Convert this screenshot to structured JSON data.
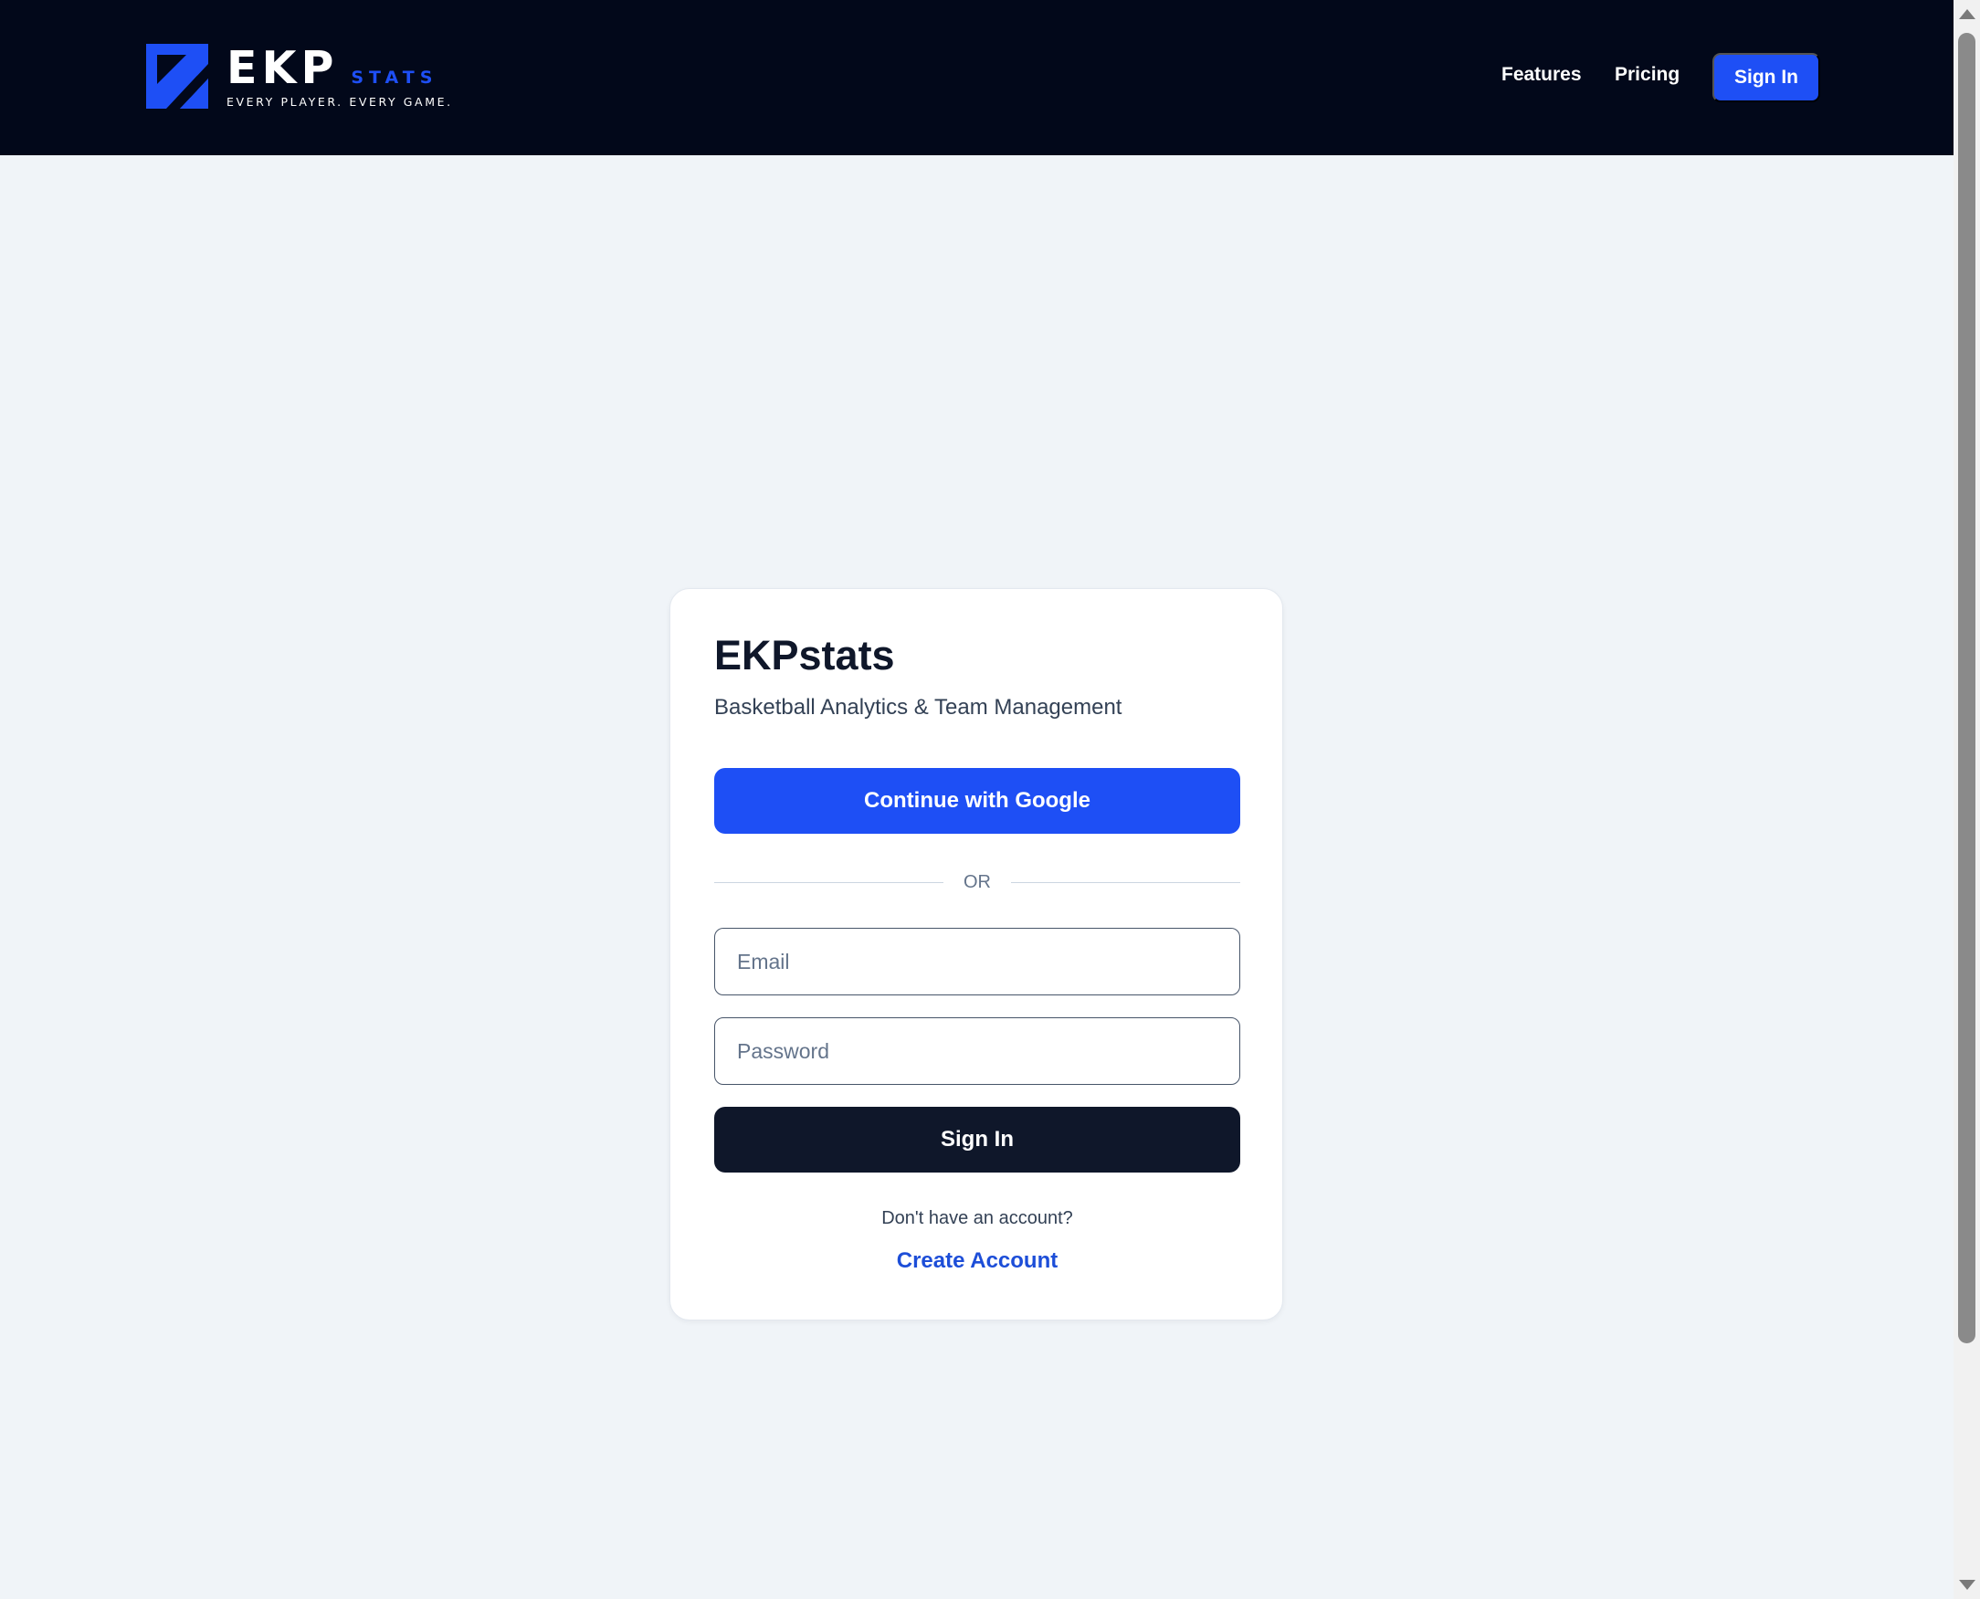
{
  "header": {
    "logo": {
      "name": "EKP",
      "suffix": "STATS",
      "tagline": "EVERY PLAYER. EVERY GAME.",
      "icon": "ekp-logo-mark"
    },
    "nav": {
      "features": "Features",
      "pricing": "Pricing",
      "sign_in": "Sign In"
    }
  },
  "card": {
    "title": "EKPstats",
    "subtitle": "Basketball Analytics & Team Management",
    "google_button": "Continue with Google",
    "divider": "OR",
    "email": {
      "placeholder": "Email",
      "value": ""
    },
    "password": {
      "placeholder": "Password",
      "value": ""
    },
    "sign_in_button": "Sign In",
    "no_account_text": "Don't have an account?",
    "create_account_link": "Create Account"
  },
  "colors": {
    "header_bg": "#02081a",
    "page_bg": "#f0f4f8",
    "brand_blue": "#1e4ff5",
    "dark_button": "#0f172a",
    "link_blue": "#1d4ed8"
  }
}
